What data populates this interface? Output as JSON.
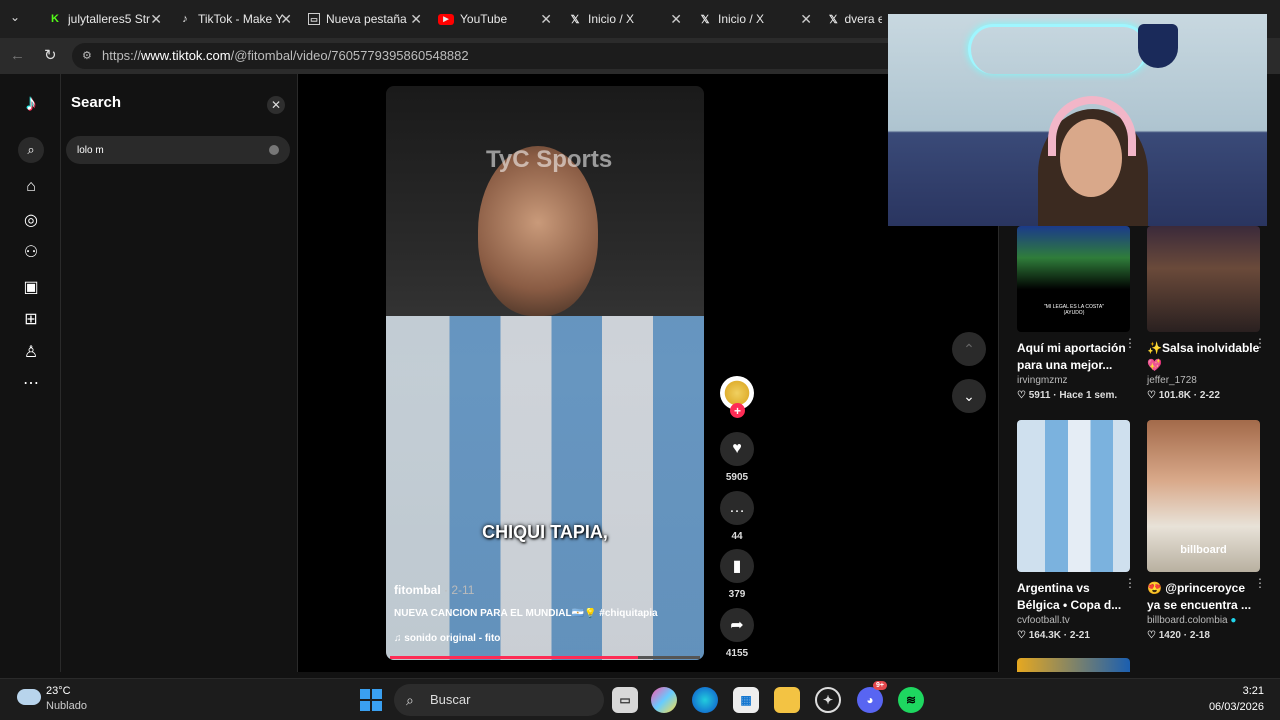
{
  "browser": {
    "tabs": [
      {
        "label": "julytalleres5 Str",
        "icon": "kick-icon",
        "color": "#53fc18"
      },
      {
        "label": "TikTok - Make Y",
        "icon": "tiktok-icon",
        "color": "#ffffff"
      },
      {
        "label": "Nueva pestaña",
        "icon": "new-tab-icon",
        "color": "#ffffff"
      },
      {
        "label": "YouTube",
        "icon": "youtube-icon",
        "color": "#ff0000"
      },
      {
        "label": "Inicio / X",
        "icon": "x-icon",
        "color": "#ffffff"
      },
      {
        "label": "Inicio / X",
        "icon": "x-icon",
        "color": "#ffffff"
      },
      {
        "label": "dvera en",
        "icon": "x-icon",
        "color": "#ffffff"
      }
    ],
    "url_prefix": "https://",
    "url_domain": "www.tiktok.com",
    "url_path": "/@fitombal/video/7605779395860548882"
  },
  "sidebar": {
    "icons": [
      "tiktok-logo-icon",
      "search-icon",
      "home-icon",
      "explore-icon",
      "following-icon",
      "live-icon",
      "upload-icon",
      "profile-icon",
      "more-icon"
    ]
  },
  "search": {
    "title": "Search",
    "query": "lolo m"
  },
  "video": {
    "watermark": "TyC Sports",
    "subtitle": "CHIQUI TAPIA,",
    "author": "fitombal",
    "date": " · 2-11",
    "caption": "NUEVA CANCIÓN PARA EL MUNDIAL🇦🇷💡 #chiquitapia",
    "sound": "sonido original - fito",
    "progress": 0.8,
    "likes": "5905",
    "comments": "44",
    "saves": "379",
    "shares": "4155"
  },
  "recommendations": [
    {
      "title": "Aquí mi aportación para una mejor...",
      "author": "irvingmzmz",
      "stats": "♡ 5911 · Hace 1 sem."
    },
    {
      "title": "✨Salsa inolvidable 💖",
      "author": "jeffer_1728",
      "stats": "♡ 101.8K · 2-22"
    },
    {
      "title": "Argentina vs Bélgica • Copa d...",
      "author": "cvfootball.tv",
      "stats": "♡ 164.3K · 2-21"
    },
    {
      "title": "😍 @princeroyce ya se encuentra ...",
      "author": "billboard.colombia",
      "stats": "♡ 1420 · 2-18"
    }
  ],
  "thumbs_text": {
    "t1_caption": "\"MI LEGAL ES LA COSTA\" (AYUDO)",
    "t4_caption": "billboard"
  },
  "taskbar": {
    "temperature": "23°C",
    "weather": "Nublado",
    "search_label": "Buscar",
    "time": "3:21",
    "date": "06/03/2026",
    "discord_badge": "9+"
  },
  "colors": {
    "accent": "#fe2c55",
    "background": "#121212"
  }
}
